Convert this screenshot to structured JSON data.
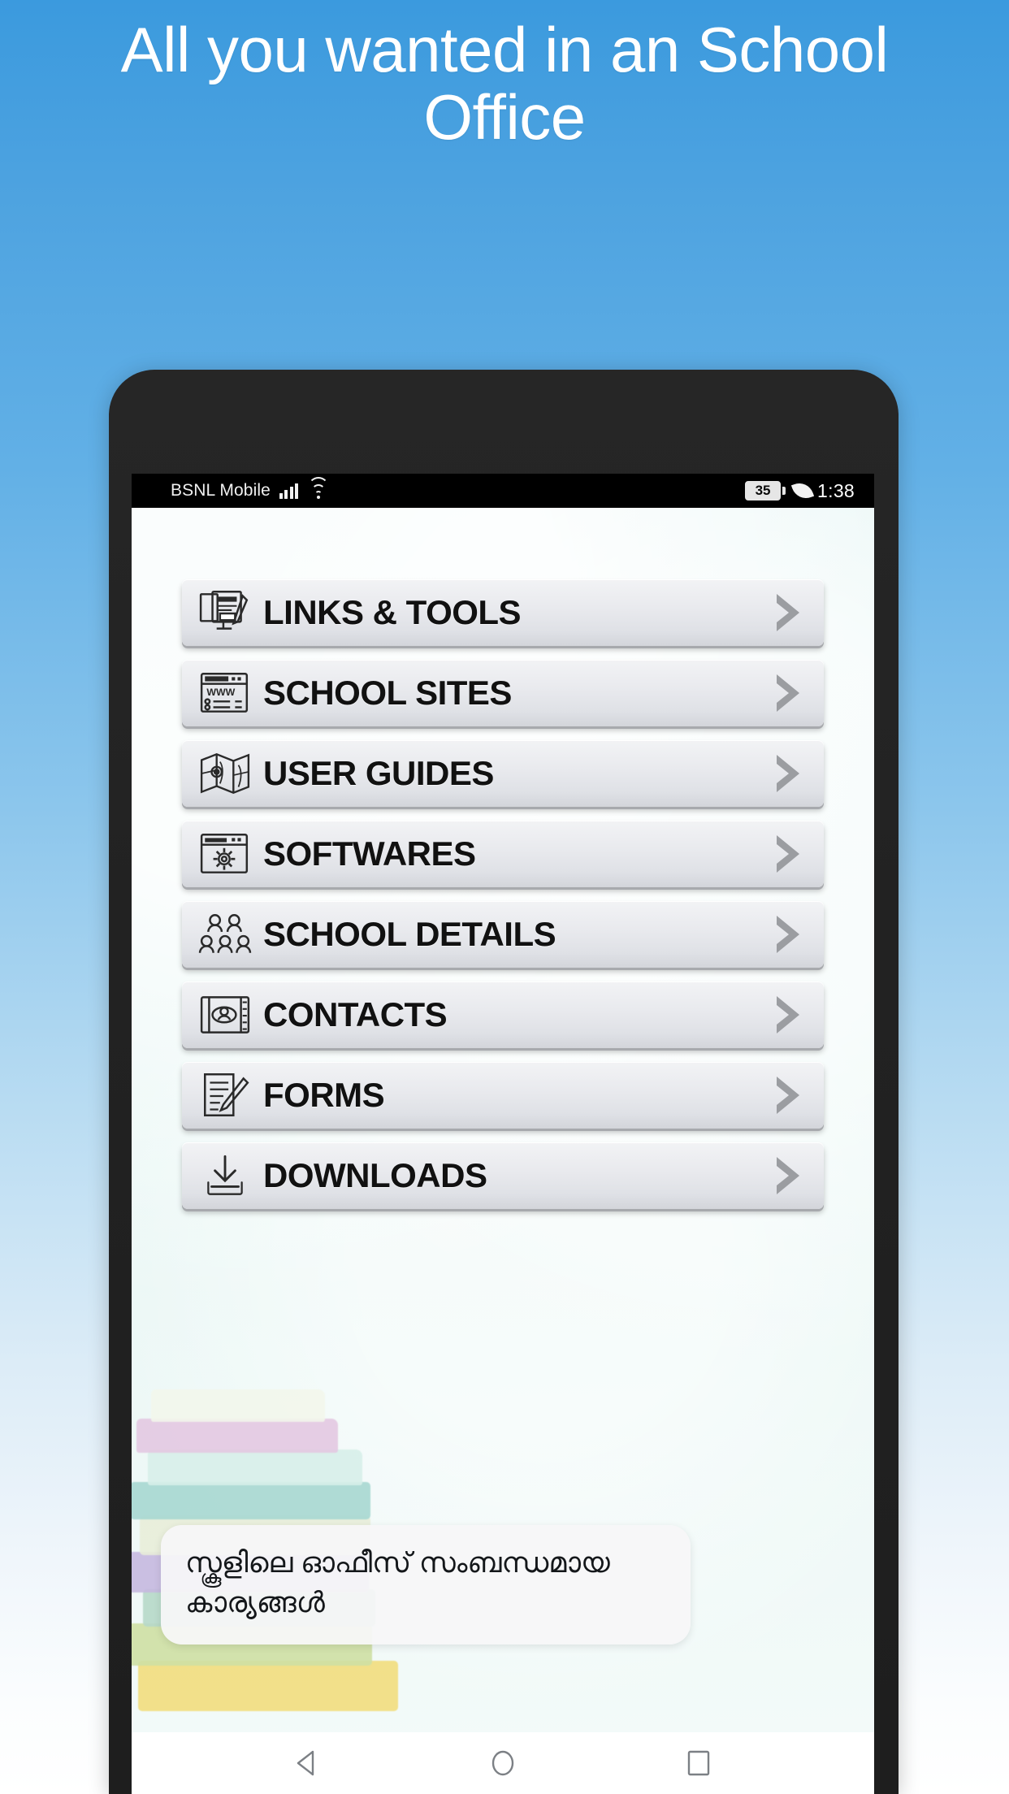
{
  "promo": {
    "headline": "All you wanted in an School\nOffice",
    "headline_color": "#ffffff",
    "background_top_color": "#3b9ade",
    "background_bottom_color": "#ffffff"
  },
  "status_bar": {
    "carrier": "BSNL Mobile",
    "signal_icon": "signal-bars-icon",
    "wifi_icon": "wifi-icon",
    "battery_level": "35",
    "battery_icon": "battery-icon",
    "power_saving_icon": "leaf-icon",
    "time": "1:38"
  },
  "app": {
    "background_color": "#e7f6f5",
    "menu": [
      {
        "label": "LINKS & TOOLS",
        "icon": "monitor-pencil-icon",
        "chevron": "chevron-right-icon"
      },
      {
        "label": "SCHOOL SITES",
        "icon": "browser-www-icon",
        "chevron": "chevron-right-icon"
      },
      {
        "label": "USER GUIDES",
        "icon": "map-icon",
        "chevron": "chevron-right-icon"
      },
      {
        "label": "SOFTWARES",
        "icon": "gear-window-icon",
        "chevron": "chevron-right-icon"
      },
      {
        "label": "SCHOOL DETAILS",
        "icon": "people-group-icon",
        "chevron": "chevron-right-icon"
      },
      {
        "label": "CONTACTS",
        "icon": "contact-book-icon",
        "chevron": "chevron-right-icon"
      },
      {
        "label": "FORMS",
        "icon": "document-pen-icon",
        "chevron": "chevron-right-icon"
      },
      {
        "label": "DOWNLOADS",
        "icon": "download-arrow-icon",
        "chevron": "chevron-right-icon"
      }
    ],
    "caption": "സ്കൂളിലെ ഓഫീസ് സംബന്ധമായ കാര്യങ്ങൾ"
  },
  "nav_bar": {
    "back": "back-triangle-icon",
    "home": "home-circle-icon",
    "recents": "recents-square-icon"
  }
}
